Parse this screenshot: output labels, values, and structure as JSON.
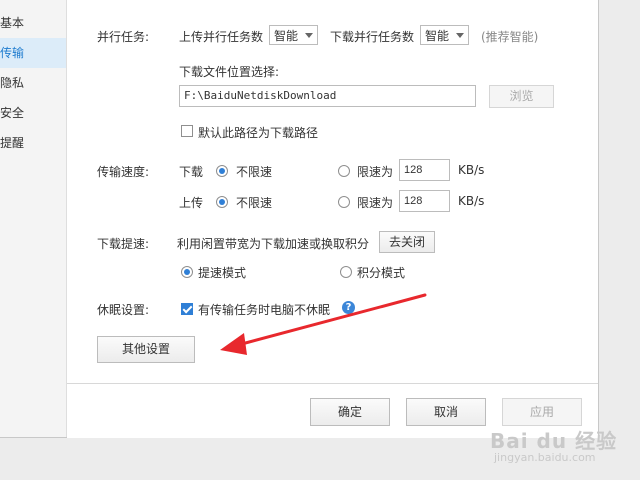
{
  "colors": {
    "accent": "#1f7ccf",
    "arrow": "#e8282d",
    "disabled_text": "#aaaaaa"
  },
  "sidebar": {
    "items": [
      {
        "label": "基本",
        "active": false
      },
      {
        "label": "传输",
        "active": true
      },
      {
        "label": "隐私",
        "active": false
      },
      {
        "label": "安全",
        "active": false
      },
      {
        "label": "提醒",
        "active": false
      }
    ]
  },
  "parallel": {
    "label": "并行任务:",
    "upload_label": "上传并行任务数",
    "upload_value": "智能",
    "download_label": "下载并行任务数",
    "download_value": "智能",
    "hint": "(推荐智能)"
  },
  "download_location": {
    "label": "下载文件位置选择:",
    "path": "F:\\BaiduNetdiskDownload",
    "browse_label": "浏览",
    "default_checkbox_label": "默认此路径为下载路径",
    "default_checked": false
  },
  "speed": {
    "label": "传输速度:",
    "download_label": "下载",
    "upload_label": "上传",
    "unlimited_label": "不限速",
    "limit_label": "限速为",
    "download_limit_value": "128",
    "upload_limit_value": "128",
    "unit": "KB/s"
  },
  "boost": {
    "label": "下载提速:",
    "description": "利用闲置带宽为下载加速或换取积分",
    "close_button_label": "去关闭",
    "mode_speed_label": "提速模式",
    "mode_points_label": "积分模式"
  },
  "sleep": {
    "label": "休眠设置:",
    "checkbox_label": "有传输任务时电脑不休眠",
    "checked": true,
    "help_icon": "?"
  },
  "other_settings_button_label": "其他设置",
  "footer": {
    "ok_label": "确定",
    "cancel_label": "取消",
    "apply_label": "应用"
  },
  "watermark": {
    "brand": "Bai du 经验",
    "url": "jingyan.baidu.com"
  }
}
